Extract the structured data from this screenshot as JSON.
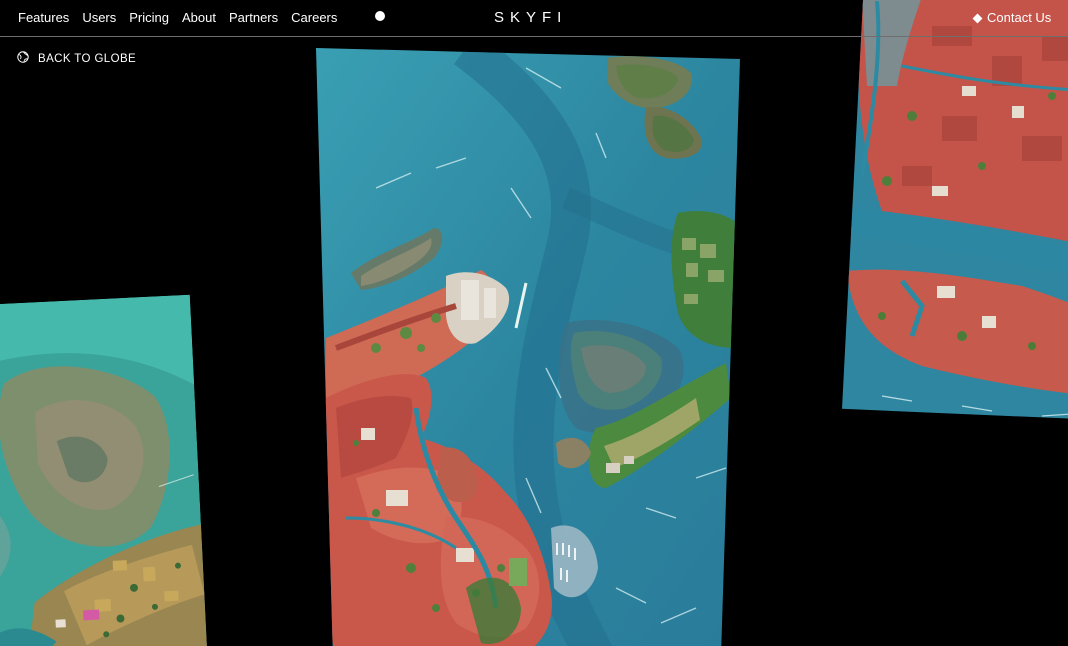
{
  "nav": {
    "items": [
      {
        "label": "Features"
      },
      {
        "label": "Users"
      },
      {
        "label": "Pricing"
      },
      {
        "label": "About"
      },
      {
        "label": "Partners"
      },
      {
        "label": "Careers"
      }
    ],
    "logo": "SKYFI",
    "contact_label": "Contact Us"
  },
  "back": {
    "label": "BACK TO GLOBE",
    "icon": "globe-icon"
  },
  "icons": {
    "status": "status-dot",
    "contact": "diamond-icon"
  },
  "colors": {
    "background": "#000000",
    "text": "#ffffff",
    "water": "#2f8fa6",
    "deep_water": "#1d6c8c",
    "rooftops": "#c4544a",
    "vegetation": "#5b8a3e",
    "lagoon": "#4fb3a8",
    "mudflat": "#8b8a62"
  },
  "tiles": [
    {
      "name": "satellite-tile-left"
    },
    {
      "name": "satellite-tile-venice"
    },
    {
      "name": "satellite-tile-right"
    }
  ]
}
